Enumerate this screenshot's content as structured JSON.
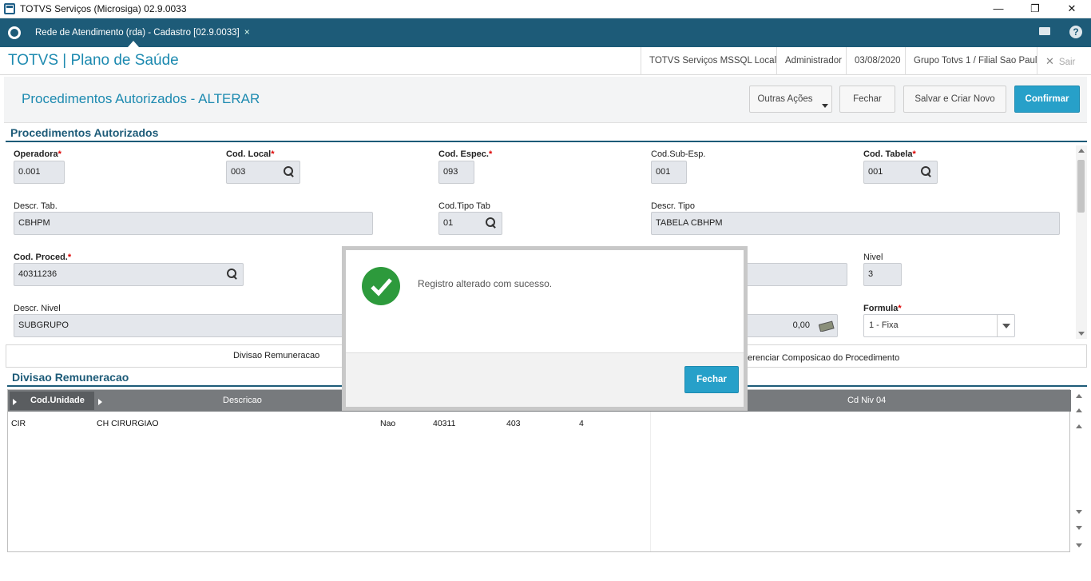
{
  "window": {
    "title": "TOTVS Serviços (Microsiga) 02.9.0033"
  },
  "tabbar": {
    "tab_label": "Rede de Atendimento (rda) - Cadastro [02.9.0033]",
    "tab_close": "×",
    "help": "?"
  },
  "header": {
    "brand": "TOTVS | Plano de Saúde",
    "server": "TOTVS Serviços MSSQL Local",
    "user": "Administrador",
    "date": "03/08/2020",
    "branch": "Grupo Totvs 1 / Filial Sao Paul",
    "exit": "Sair"
  },
  "page": {
    "title": "Procedimentos Autorizados - ALTERAR",
    "actions": {
      "more": "Outras Ações",
      "close": "Fechar",
      "save_new": "Salvar e Criar Novo",
      "confirm": "Confirmar"
    }
  },
  "form": {
    "section": "Procedimentos Autorizados",
    "required_mark": "*",
    "operadora": {
      "label": "Operadora",
      "value": "0.001"
    },
    "cod_local": {
      "label": "Cod. Local",
      "value": "003"
    },
    "cod_espec": {
      "label": "Cod. Espec.",
      "value": "093"
    },
    "cod_sub_esp": {
      "label": "Cod.Sub-Esp.",
      "value": "001"
    },
    "cod_tabela": {
      "label": "Cod. Tabela",
      "value": "001"
    },
    "descr_tab": {
      "label": "Descr. Tab.",
      "value": "CBHPM"
    },
    "cod_tipo_tab": {
      "label": "Cod.Tipo Tab",
      "value": "01"
    },
    "descr_tipo": {
      "label": "Descr. Tipo",
      "value": "TABELA CBHPM"
    },
    "cod_proced": {
      "label": "Cod. Proced.",
      "value": "40311236"
    },
    "nivel": {
      "label": "Nivel",
      "value": "3"
    },
    "descr_nivel": {
      "label": "Descr. Nivel",
      "value": "SUBGRUPO"
    },
    "valor": {
      "value": "0,00"
    },
    "formula": {
      "label": "Formula",
      "value": "1 - Fixa"
    }
  },
  "tabs": {
    "divisao": "Divisao Remuneracao",
    "diferenciar": "ferenciar Composicao do Procedimento"
  },
  "grid": {
    "section": "Divisao Remuneracao",
    "columns": {
      "cod_unidade": "Cod.Unidade",
      "descricao": "Descricao",
      "cd_niv04": "Cd Niv 04"
    },
    "row": {
      "c1": "CIR",
      "c2": "CH CIRURGIAO",
      "c3": "Nao",
      "c4": "40311",
      "c5": "403",
      "c6": "4"
    }
  },
  "modal": {
    "message": "Registro alterado com sucesso.",
    "button": "Fechar"
  }
}
